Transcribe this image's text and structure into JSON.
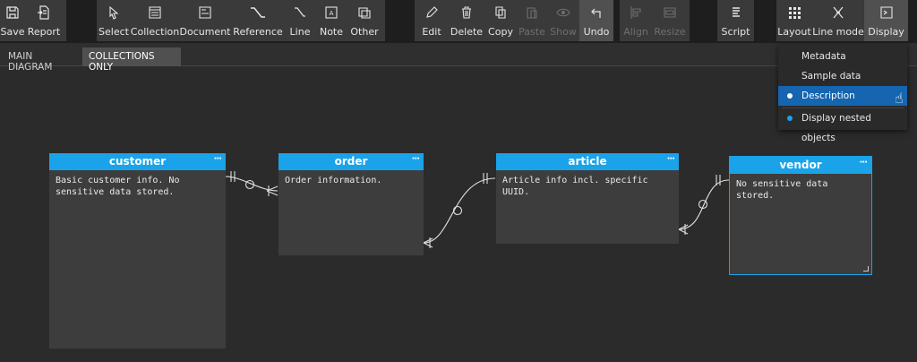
{
  "toolbar": {
    "groups": [
      [
        {
          "label": "Save",
          "icon": "save-icon"
        },
        {
          "label": "Report",
          "icon": "report-icon"
        }
      ],
      [
        {
          "label": "Select",
          "icon": "cursor-icon"
        },
        {
          "label": "Collection",
          "icon": "collection-icon"
        },
        {
          "label": "Document",
          "icon": "document-icon"
        },
        {
          "label": "Reference",
          "icon": "reference-icon"
        },
        {
          "label": "Line",
          "icon": "line-icon"
        },
        {
          "label": "Note",
          "icon": "note-icon"
        },
        {
          "label": "Other",
          "icon": "other-icon"
        }
      ],
      [
        {
          "label": "Edit",
          "icon": "pencil-icon"
        },
        {
          "label": "Delete",
          "icon": "trash-icon"
        },
        {
          "label": "Copy",
          "icon": "copy-icon"
        },
        {
          "label": "Paste",
          "icon": "paste-icon",
          "disabled": true
        },
        {
          "label": "Show",
          "icon": "eye-icon",
          "disabled": true
        },
        {
          "label": "Undo",
          "icon": "undo-icon",
          "active": true
        }
      ],
      [
        {
          "label": "Align",
          "icon": "align-icon",
          "disabled": true
        },
        {
          "label": "Resize",
          "icon": "resize-icon",
          "disabled": true
        }
      ],
      [
        {
          "label": "Script",
          "icon": "script-icon"
        }
      ],
      [
        {
          "label": "Layout",
          "icon": "layout-icon"
        },
        {
          "label": "Line mode",
          "icon": "line-mode-icon"
        },
        {
          "label": "Display",
          "icon": "display-icon",
          "active": true
        }
      ]
    ]
  },
  "tabs": [
    {
      "label": "MAIN DIAGRAM",
      "active": false
    },
    {
      "label": "COLLECTIONS ONLY",
      "active": true
    }
  ],
  "entities": [
    {
      "name": "customer",
      "description": "Basic customer info. No sensitive data stored."
    },
    {
      "name": "order",
      "description": "Order information."
    },
    {
      "name": "article",
      "description": "Article info incl. specific UUID."
    },
    {
      "name": "vendor",
      "description": "No sensitive data stored.",
      "selected": true
    }
  ],
  "entity_menu_glyph": "···",
  "display_menu": {
    "items": [
      {
        "label": "Metadata",
        "dot": false
      },
      {
        "label": "Sample data",
        "dot": false
      },
      {
        "label": "Description",
        "dot": true,
        "highlight": true
      },
      {
        "label": "Display nested objects",
        "dot": true,
        "dot_color": "#1aa3e8"
      }
    ]
  },
  "colors": {
    "accent": "#1aa3e8",
    "menu_highlight": "#1565b0"
  }
}
